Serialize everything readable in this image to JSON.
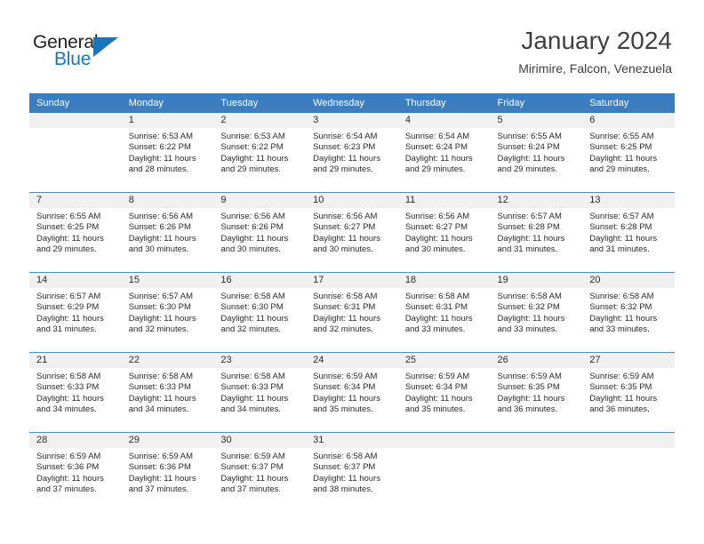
{
  "brand": {
    "name_part1": "General",
    "name_part2": "Blue",
    "accent_color": "#1b75bb"
  },
  "header": {
    "title": "January 2024",
    "subtitle": "Mirimire, Falcon, Venezuela"
  },
  "calendar": {
    "header_color": "#3b7dbf",
    "weekdays": [
      "Sunday",
      "Monday",
      "Tuesday",
      "Wednesday",
      "Thursday",
      "Friday",
      "Saturday"
    ],
    "labels": {
      "sunrise": "Sunrise:",
      "sunset": "Sunset:",
      "daylight": "Daylight:"
    },
    "weeks": [
      [
        {
          "day": "",
          "sunrise": "",
          "sunset": "",
          "daylight_line1": "",
          "daylight_line2": ""
        },
        {
          "day": "1",
          "sunrise": "Sunrise: 6:53 AM",
          "sunset": "Sunset: 6:22 PM",
          "daylight_line1": "Daylight: 11 hours",
          "daylight_line2": "and 28 minutes."
        },
        {
          "day": "2",
          "sunrise": "Sunrise: 6:53 AM",
          "sunset": "Sunset: 6:22 PM",
          "daylight_line1": "Daylight: 11 hours",
          "daylight_line2": "and 29 minutes."
        },
        {
          "day": "3",
          "sunrise": "Sunrise: 6:54 AM",
          "sunset": "Sunset: 6:23 PM",
          "daylight_line1": "Daylight: 11 hours",
          "daylight_line2": "and 29 minutes."
        },
        {
          "day": "4",
          "sunrise": "Sunrise: 6:54 AM",
          "sunset": "Sunset: 6:24 PM",
          "daylight_line1": "Daylight: 11 hours",
          "daylight_line2": "and 29 minutes."
        },
        {
          "day": "5",
          "sunrise": "Sunrise: 6:55 AM",
          "sunset": "Sunset: 6:24 PM",
          "daylight_line1": "Daylight: 11 hours",
          "daylight_line2": "and 29 minutes."
        },
        {
          "day": "6",
          "sunrise": "Sunrise: 6:55 AM",
          "sunset": "Sunset: 6:25 PM",
          "daylight_line1": "Daylight: 11 hours",
          "daylight_line2": "and 29 minutes."
        }
      ],
      [
        {
          "day": "7",
          "sunrise": "Sunrise: 6:55 AM",
          "sunset": "Sunset: 6:25 PM",
          "daylight_line1": "Daylight: 11 hours",
          "daylight_line2": "and 29 minutes."
        },
        {
          "day": "8",
          "sunrise": "Sunrise: 6:56 AM",
          "sunset": "Sunset: 6:26 PM",
          "daylight_line1": "Daylight: 11 hours",
          "daylight_line2": "and 30 minutes."
        },
        {
          "day": "9",
          "sunrise": "Sunrise: 6:56 AM",
          "sunset": "Sunset: 6:26 PM",
          "daylight_line1": "Daylight: 11 hours",
          "daylight_line2": "and 30 minutes."
        },
        {
          "day": "10",
          "sunrise": "Sunrise: 6:56 AM",
          "sunset": "Sunset: 6:27 PM",
          "daylight_line1": "Daylight: 11 hours",
          "daylight_line2": "and 30 minutes."
        },
        {
          "day": "11",
          "sunrise": "Sunrise: 6:56 AM",
          "sunset": "Sunset: 6:27 PM",
          "daylight_line1": "Daylight: 11 hours",
          "daylight_line2": "and 30 minutes."
        },
        {
          "day": "12",
          "sunrise": "Sunrise: 6:57 AM",
          "sunset": "Sunset: 6:28 PM",
          "daylight_line1": "Daylight: 11 hours",
          "daylight_line2": "and 31 minutes."
        },
        {
          "day": "13",
          "sunrise": "Sunrise: 6:57 AM",
          "sunset": "Sunset: 6:28 PM",
          "daylight_line1": "Daylight: 11 hours",
          "daylight_line2": "and 31 minutes."
        }
      ],
      [
        {
          "day": "14",
          "sunrise": "Sunrise: 6:57 AM",
          "sunset": "Sunset: 6:29 PM",
          "daylight_line1": "Daylight: 11 hours",
          "daylight_line2": "and 31 minutes."
        },
        {
          "day": "15",
          "sunrise": "Sunrise: 6:57 AM",
          "sunset": "Sunset: 6:30 PM",
          "daylight_line1": "Daylight: 11 hours",
          "daylight_line2": "and 32 minutes."
        },
        {
          "day": "16",
          "sunrise": "Sunrise: 6:58 AM",
          "sunset": "Sunset: 6:30 PM",
          "daylight_line1": "Daylight: 11 hours",
          "daylight_line2": "and 32 minutes."
        },
        {
          "day": "17",
          "sunrise": "Sunrise: 6:58 AM",
          "sunset": "Sunset: 6:31 PM",
          "daylight_line1": "Daylight: 11 hours",
          "daylight_line2": "and 32 minutes."
        },
        {
          "day": "18",
          "sunrise": "Sunrise: 6:58 AM",
          "sunset": "Sunset: 6:31 PM",
          "daylight_line1": "Daylight: 11 hours",
          "daylight_line2": "and 33 minutes."
        },
        {
          "day": "19",
          "sunrise": "Sunrise: 6:58 AM",
          "sunset": "Sunset: 6:32 PM",
          "daylight_line1": "Daylight: 11 hours",
          "daylight_line2": "and 33 minutes."
        },
        {
          "day": "20",
          "sunrise": "Sunrise: 6:58 AM",
          "sunset": "Sunset: 6:32 PM",
          "daylight_line1": "Daylight: 11 hours",
          "daylight_line2": "and 33 minutes."
        }
      ],
      [
        {
          "day": "21",
          "sunrise": "Sunrise: 6:58 AM",
          "sunset": "Sunset: 6:33 PM",
          "daylight_line1": "Daylight: 11 hours",
          "daylight_line2": "and 34 minutes."
        },
        {
          "day": "22",
          "sunrise": "Sunrise: 6:58 AM",
          "sunset": "Sunset: 6:33 PM",
          "daylight_line1": "Daylight: 11 hours",
          "daylight_line2": "and 34 minutes."
        },
        {
          "day": "23",
          "sunrise": "Sunrise: 6:58 AM",
          "sunset": "Sunset: 6:33 PM",
          "daylight_line1": "Daylight: 11 hours",
          "daylight_line2": "and 34 minutes."
        },
        {
          "day": "24",
          "sunrise": "Sunrise: 6:59 AM",
          "sunset": "Sunset: 6:34 PM",
          "daylight_line1": "Daylight: 11 hours",
          "daylight_line2": "and 35 minutes."
        },
        {
          "day": "25",
          "sunrise": "Sunrise: 6:59 AM",
          "sunset": "Sunset: 6:34 PM",
          "daylight_line1": "Daylight: 11 hours",
          "daylight_line2": "and 35 minutes."
        },
        {
          "day": "26",
          "sunrise": "Sunrise: 6:59 AM",
          "sunset": "Sunset: 6:35 PM",
          "daylight_line1": "Daylight: 11 hours",
          "daylight_line2": "and 36 minutes."
        },
        {
          "day": "27",
          "sunrise": "Sunrise: 6:59 AM",
          "sunset": "Sunset: 6:35 PM",
          "daylight_line1": "Daylight: 11 hours",
          "daylight_line2": "and 36 minutes."
        }
      ],
      [
        {
          "day": "28",
          "sunrise": "Sunrise: 6:59 AM",
          "sunset": "Sunset: 6:36 PM",
          "daylight_line1": "Daylight: 11 hours",
          "daylight_line2": "and 37 minutes."
        },
        {
          "day": "29",
          "sunrise": "Sunrise: 6:59 AM",
          "sunset": "Sunset: 6:36 PM",
          "daylight_line1": "Daylight: 11 hours",
          "daylight_line2": "and 37 minutes."
        },
        {
          "day": "30",
          "sunrise": "Sunrise: 6:59 AM",
          "sunset": "Sunset: 6:37 PM",
          "daylight_line1": "Daylight: 11 hours",
          "daylight_line2": "and 37 minutes."
        },
        {
          "day": "31",
          "sunrise": "Sunrise: 6:58 AM",
          "sunset": "Sunset: 6:37 PM",
          "daylight_line1": "Daylight: 11 hours",
          "daylight_line2": "and 38 minutes."
        },
        {
          "day": "",
          "sunrise": "",
          "sunset": "",
          "daylight_line1": "",
          "daylight_line2": ""
        },
        {
          "day": "",
          "sunrise": "",
          "sunset": "",
          "daylight_line1": "",
          "daylight_line2": ""
        },
        {
          "day": "",
          "sunrise": "",
          "sunset": "",
          "daylight_line1": "",
          "daylight_line2": ""
        }
      ]
    ]
  }
}
